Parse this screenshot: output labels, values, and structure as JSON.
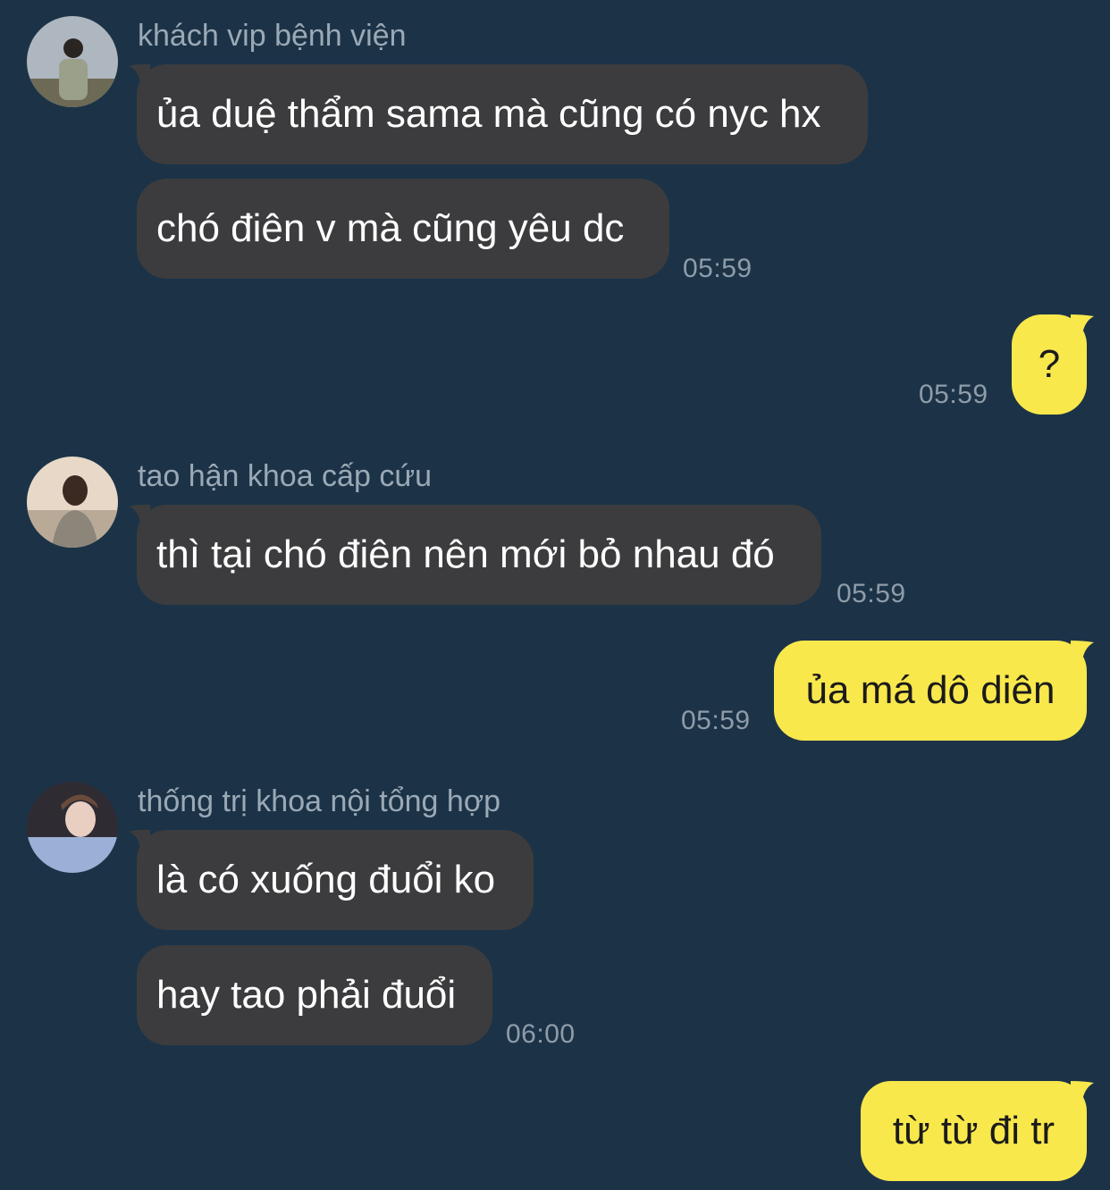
{
  "colors": {
    "background": "#1c3347",
    "incoming_bubble": "#3c3c3e",
    "outgoing_bubble": "#f9e84c",
    "meta_text": "#9aa9b6"
  },
  "messages": [
    {
      "type": "incoming",
      "sender": "khách vip bệnh viện",
      "avatar_icon": "avatar-photo",
      "lines": [
        "ủa duệ thẩm sama mà cũng có nyc hx",
        "chó điên v mà cũng yêu dc"
      ],
      "time": "05:59"
    },
    {
      "type": "outgoing",
      "lines": [
        "?"
      ],
      "time": "05:59"
    },
    {
      "type": "incoming",
      "sender": "tao hận khoa cấp cứu",
      "avatar_icon": "avatar-photo",
      "lines": [
        "thì tại chó điên nên mới bỏ nhau đó"
      ],
      "time": "05:59"
    },
    {
      "type": "outgoing",
      "lines": [
        "ủa má dô diên"
      ],
      "time": "05:59"
    },
    {
      "type": "incoming",
      "sender": "thống trị khoa nội tổng hợp",
      "avatar_icon": "avatar-photo",
      "lines": [
        "là có xuống đuổi ko",
        "hay tao phải đuổi"
      ],
      "time": "06:00"
    },
    {
      "type": "outgoing",
      "lines": [
        "từ từ đi tr"
      ]
    }
  ]
}
